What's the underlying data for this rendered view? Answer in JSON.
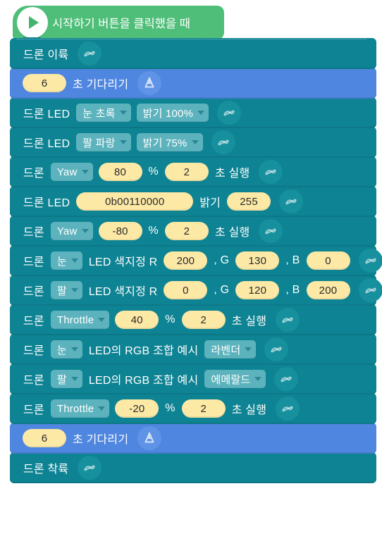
{
  "editor": {
    "name": "block-script-canvas",
    "background": "#ffffff",
    "colors": {
      "hat_green": "#4fbe78",
      "drone_teal": "#0e8393",
      "wait_blue": "#4f86e0",
      "dropdown_field": "#5db3bd",
      "number_field": "#fde9a6",
      "badge_teal": "#17909e",
      "badge_blue": "#5e93e6",
      "label_text": "#ffffff",
      "field_text": "#2b2b2b"
    }
  },
  "script": {
    "hat": {
      "label": "시작하기 버튼을 클릭했을 때",
      "icon": "play-icon"
    },
    "blocks": [
      {
        "id": "takeoff",
        "type": "drone",
        "badge": "drone-link-icon",
        "parts": [
          {
            "kind": "label",
            "text": "드론 이륙"
          }
        ]
      },
      {
        "id": "wait-1",
        "type": "wait",
        "badge": "drone-hardware-icon",
        "parts": [
          {
            "kind": "number",
            "text": "6"
          },
          {
            "kind": "label",
            "text": "초 기다리기"
          }
        ]
      },
      {
        "id": "led-preset-1",
        "type": "drone",
        "badge": "drone-link-icon",
        "parts": [
          {
            "kind": "label",
            "text": "드론 LED"
          },
          {
            "kind": "dropdown",
            "text": "눈 초록"
          },
          {
            "kind": "dropdown",
            "text": "밝기 100%"
          }
        ]
      },
      {
        "id": "led-preset-2",
        "type": "drone",
        "badge": "drone-link-icon",
        "parts": [
          {
            "kind": "label",
            "text": "드론 LED"
          },
          {
            "kind": "dropdown",
            "text": "팔 파랑"
          },
          {
            "kind": "dropdown",
            "text": "밝기 75%"
          }
        ]
      },
      {
        "id": "move-yaw-1",
        "type": "drone",
        "badge": "drone-link-icon",
        "parts": [
          {
            "kind": "label",
            "text": "드론"
          },
          {
            "kind": "dropdown",
            "text": "Yaw"
          },
          {
            "kind": "number",
            "text": "80"
          },
          {
            "kind": "label",
            "text": "%"
          },
          {
            "kind": "number",
            "text": "2"
          },
          {
            "kind": "label",
            "text": "초 실행"
          }
        ]
      },
      {
        "id": "led-binary",
        "type": "drone",
        "badge": "drone-link-icon",
        "parts": [
          {
            "kind": "label",
            "text": "드론 LED"
          },
          {
            "kind": "number-wide",
            "text": "0b00110000"
          },
          {
            "kind": "label",
            "text": "밝기"
          },
          {
            "kind": "number",
            "text": "255"
          }
        ]
      },
      {
        "id": "move-yaw-2",
        "type": "drone",
        "badge": "drone-link-icon",
        "parts": [
          {
            "kind": "label",
            "text": "드론"
          },
          {
            "kind": "dropdown",
            "text": "Yaw"
          },
          {
            "kind": "number",
            "text": "-80"
          },
          {
            "kind": "label",
            "text": "%"
          },
          {
            "kind": "number",
            "text": "2"
          },
          {
            "kind": "label",
            "text": "초 실행"
          }
        ]
      },
      {
        "id": "led-rgb-eye",
        "type": "drone",
        "badge": "drone-link-icon",
        "parts": [
          {
            "kind": "label",
            "text": "드론"
          },
          {
            "kind": "dropdown",
            "text": "눈"
          },
          {
            "kind": "label",
            "text": "LED 색지정 R"
          },
          {
            "kind": "number",
            "text": "200"
          },
          {
            "kind": "label",
            "text": ", G"
          },
          {
            "kind": "number",
            "text": "130"
          },
          {
            "kind": "label",
            "text": ", B"
          },
          {
            "kind": "number",
            "text": "0"
          }
        ]
      },
      {
        "id": "led-rgb-arm",
        "type": "drone",
        "badge": "drone-link-icon",
        "parts": [
          {
            "kind": "label",
            "text": "드론"
          },
          {
            "kind": "dropdown",
            "text": "팔"
          },
          {
            "kind": "label",
            "text": "LED 색지정 R"
          },
          {
            "kind": "number",
            "text": "0"
          },
          {
            "kind": "label",
            "text": ", G"
          },
          {
            "kind": "number",
            "text": "120"
          },
          {
            "kind": "label",
            "text": ", B"
          },
          {
            "kind": "number",
            "text": "200"
          }
        ]
      },
      {
        "id": "move-throttle-1",
        "type": "drone",
        "badge": "drone-link-icon",
        "parts": [
          {
            "kind": "label",
            "text": "드론"
          },
          {
            "kind": "dropdown",
            "text": "Throttle"
          },
          {
            "kind": "number",
            "text": "40"
          },
          {
            "kind": "label",
            "text": "%"
          },
          {
            "kind": "number",
            "text": "2"
          },
          {
            "kind": "label",
            "text": "초 실행"
          }
        ]
      },
      {
        "id": "rgb-example-eye",
        "type": "drone",
        "badge": "drone-link-icon",
        "parts": [
          {
            "kind": "label",
            "text": "드론"
          },
          {
            "kind": "dropdown",
            "text": "눈"
          },
          {
            "kind": "label",
            "text": "LED의 RGB 조합 예시"
          },
          {
            "kind": "dropdown",
            "text": "라벤더"
          }
        ]
      },
      {
        "id": "rgb-example-arm",
        "type": "drone",
        "badge": "drone-link-icon",
        "parts": [
          {
            "kind": "label",
            "text": "드론"
          },
          {
            "kind": "dropdown",
            "text": "팔"
          },
          {
            "kind": "label",
            "text": "LED의 RGB 조합 예시"
          },
          {
            "kind": "dropdown",
            "text": "에메랄드"
          }
        ]
      },
      {
        "id": "move-throttle-2",
        "type": "drone",
        "badge": "drone-link-icon",
        "parts": [
          {
            "kind": "label",
            "text": "드론"
          },
          {
            "kind": "dropdown",
            "text": "Throttle"
          },
          {
            "kind": "number",
            "text": "-20"
          },
          {
            "kind": "label",
            "text": "%"
          },
          {
            "kind": "number",
            "text": "2"
          },
          {
            "kind": "label",
            "text": "초 실행"
          }
        ]
      },
      {
        "id": "wait-2",
        "type": "wait",
        "badge": "drone-hardware-icon",
        "parts": [
          {
            "kind": "number",
            "text": "6"
          },
          {
            "kind": "label",
            "text": "초 기다리기"
          }
        ]
      },
      {
        "id": "landing",
        "type": "drone",
        "badge": "drone-link-icon",
        "parts": [
          {
            "kind": "label",
            "text": "드론 착륙"
          }
        ]
      }
    ]
  }
}
